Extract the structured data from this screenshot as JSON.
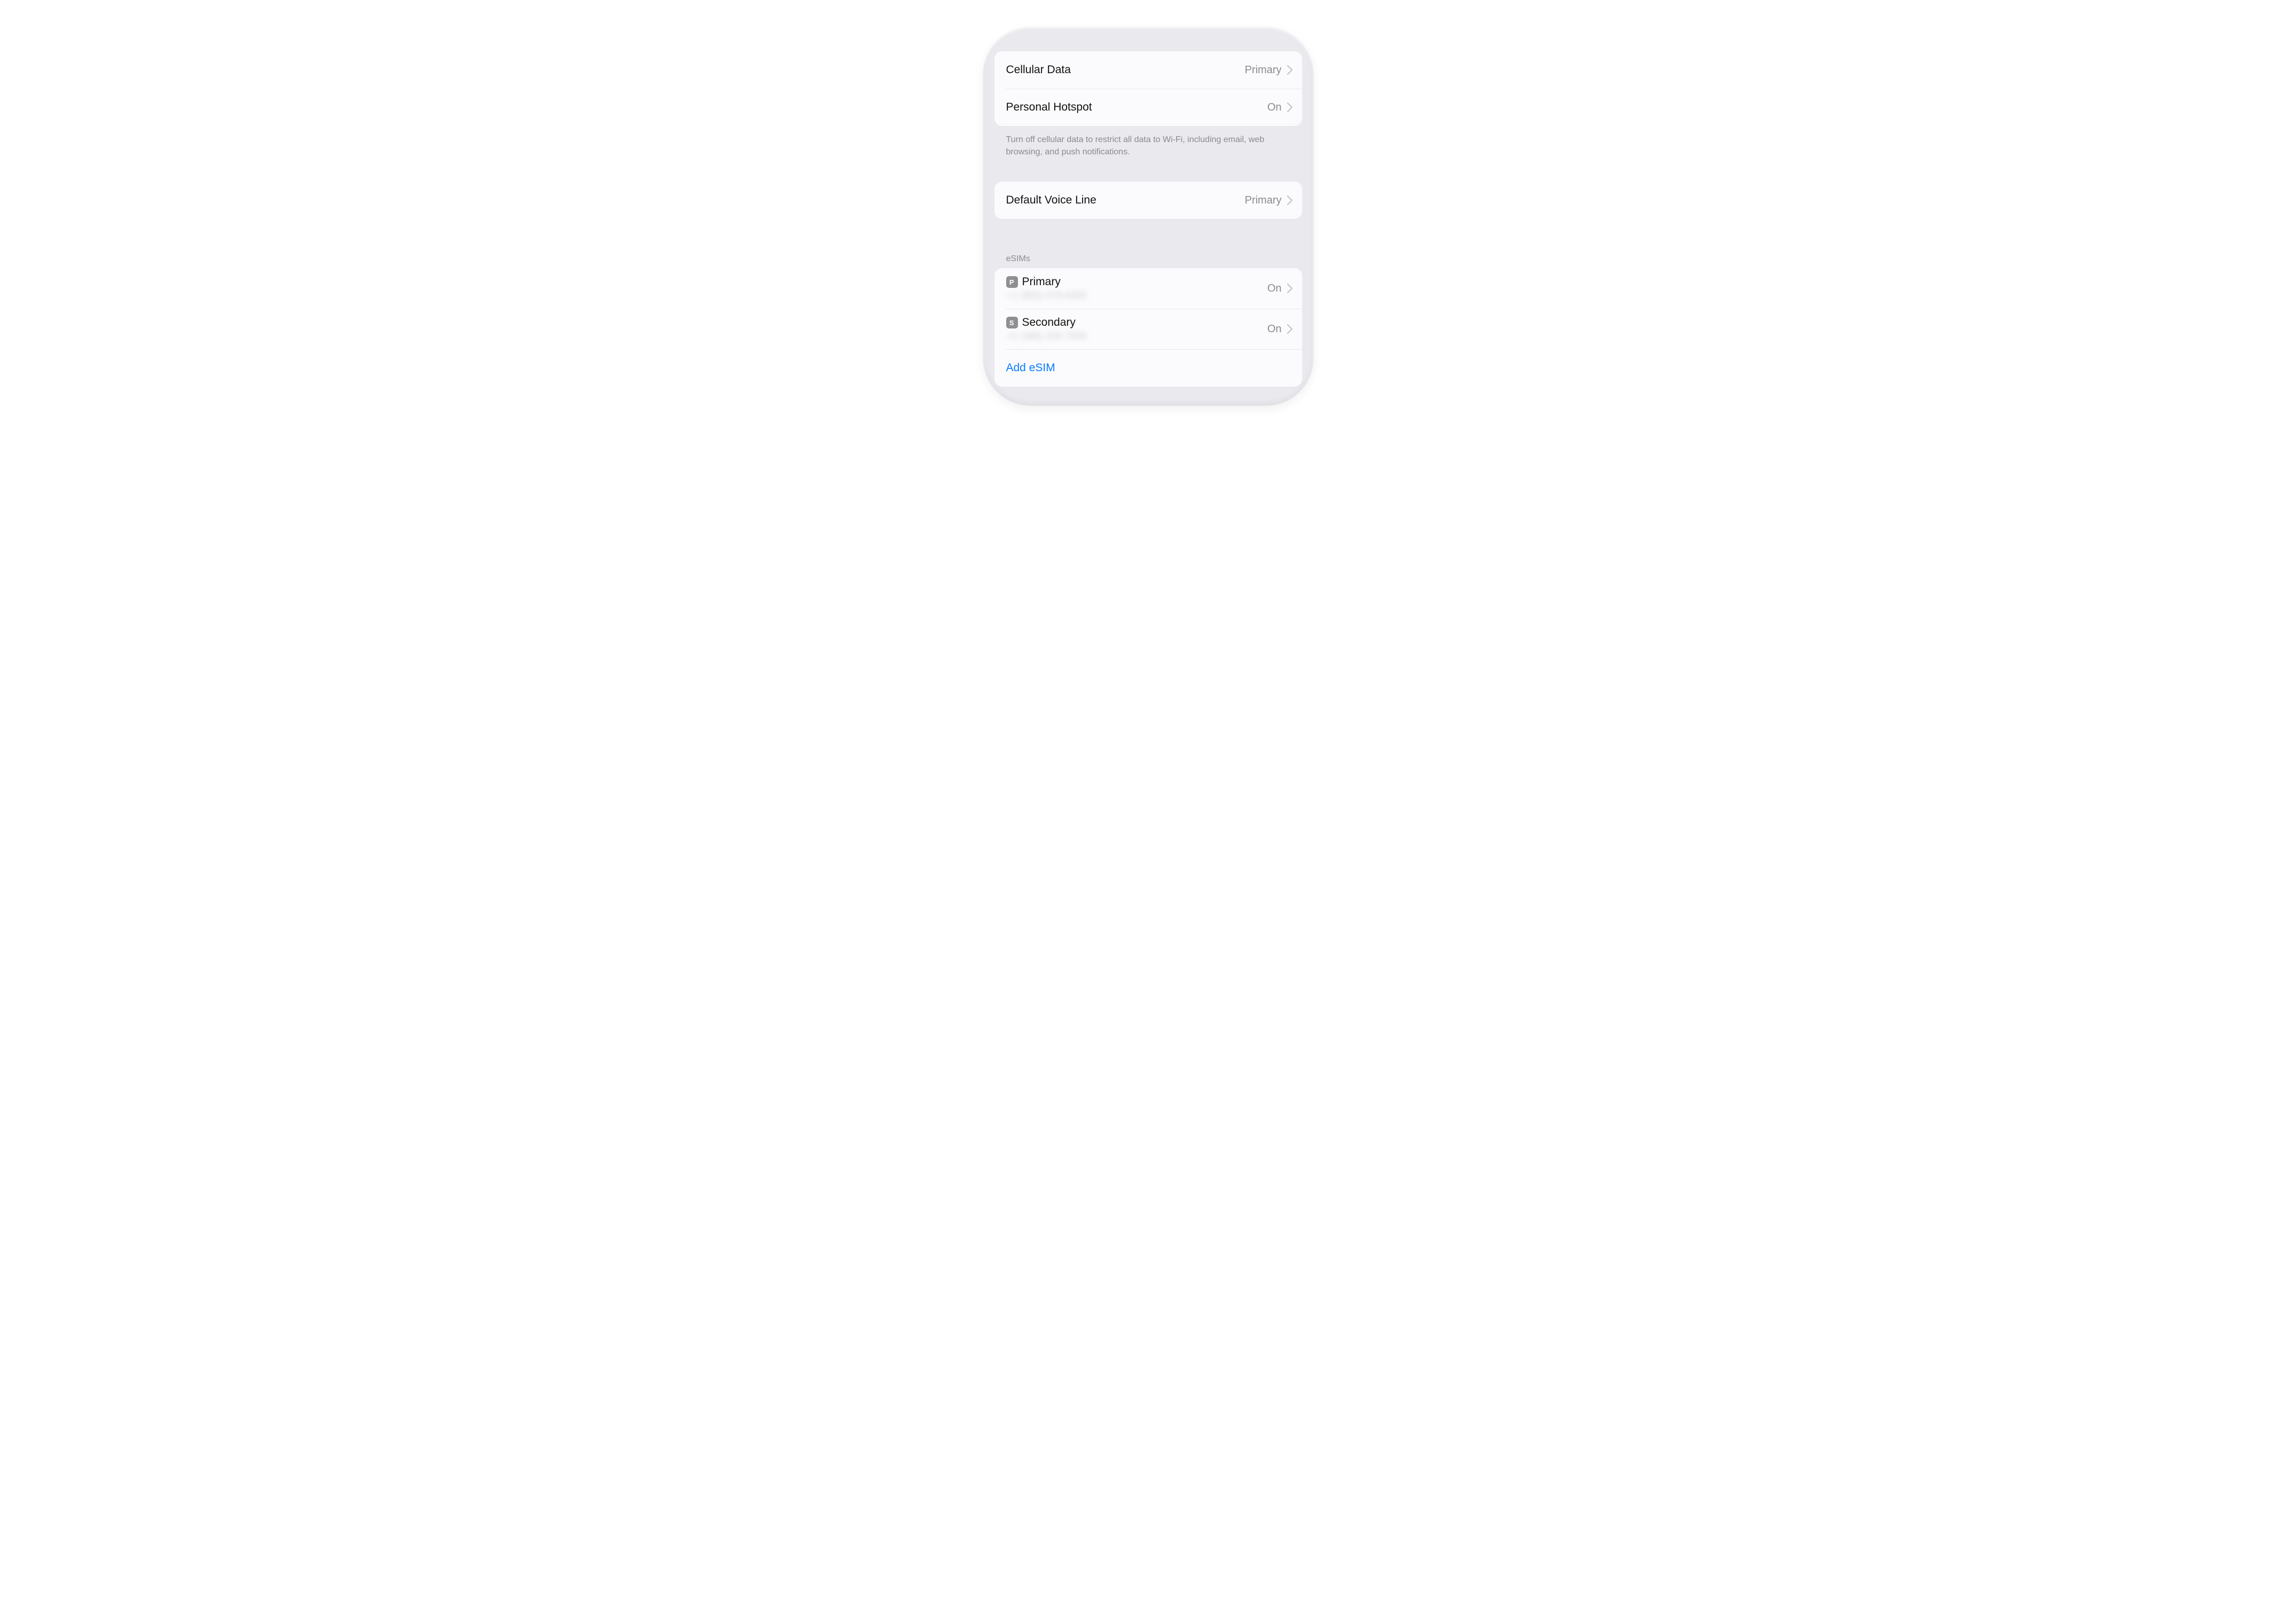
{
  "sections": {
    "data": {
      "cellular_data": {
        "label": "Cellular Data",
        "value": "Primary"
      },
      "personal_hotspot": {
        "label": "Personal Hotspot",
        "value": "On"
      },
      "footer": "Turn off cellular data to restrict all data to Wi-Fi, including email, web browsing, and push notifications."
    },
    "voice": {
      "default_voice_line": {
        "label": "Default Voice Line",
        "value": "Primary"
      }
    },
    "esims": {
      "header": "eSIMs",
      "items": [
        {
          "badge": "P",
          "name": "Primary",
          "phone": "+1 (805) 478-9300",
          "status": "On"
        },
        {
          "badge": "S",
          "name": "Secondary",
          "phone": "+1 (385) 204-7558",
          "status": "On"
        }
      ],
      "add_label": "Add eSIM"
    }
  },
  "colors": {
    "link": "#0a7bff",
    "secondary_text": "#8a8a8f",
    "badge_bg": "#8e8e93"
  }
}
